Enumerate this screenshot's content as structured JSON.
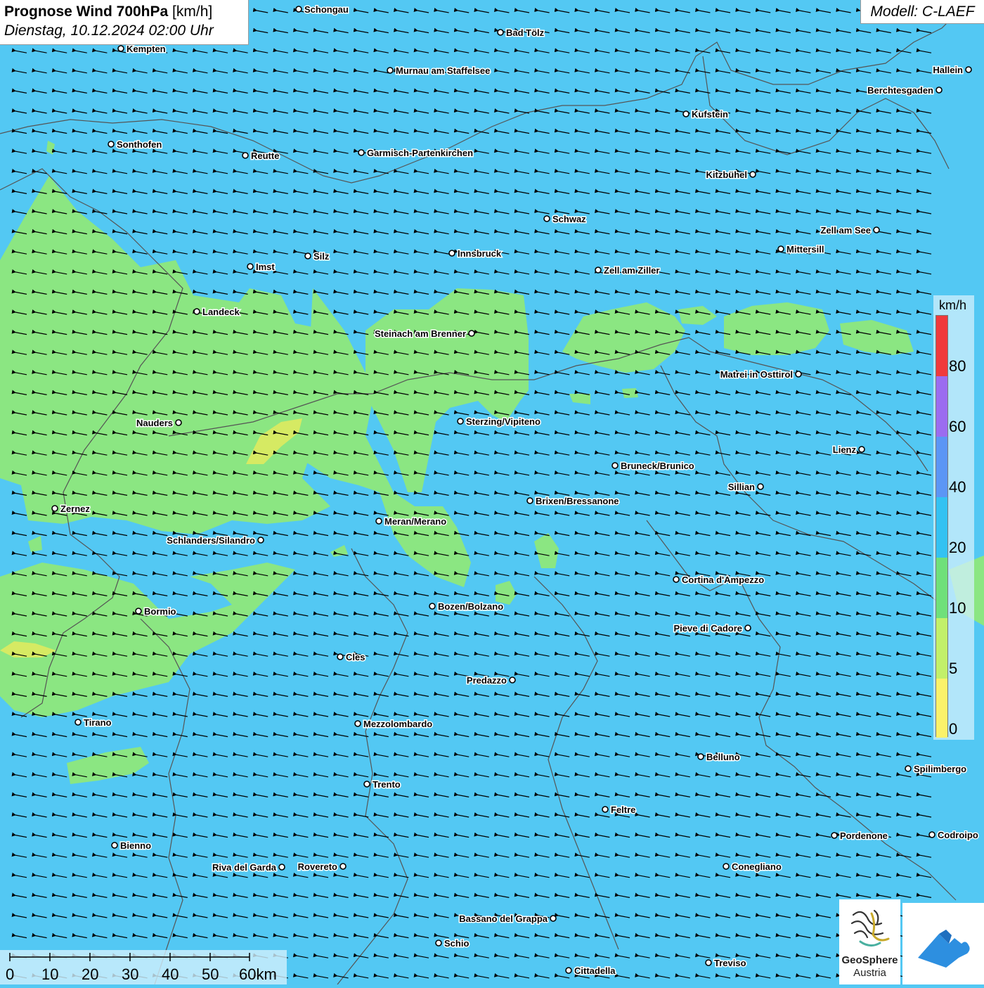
{
  "title": {
    "bold": "Prognose Wind 700hPa",
    "unit": " [km/h]",
    "date": "Dienstag, 10.12.2024 02:00 Uhr"
  },
  "model": "Modell: C-LAEF",
  "legend": {
    "unit": "km/h",
    "ticks": [
      "80",
      "60",
      "40",
      "20",
      "10",
      "5",
      "0"
    ],
    "colors": [
      "#f03a3c",
      "#9b6cf0",
      "#5b96f5",
      "#33c2f2",
      "#6fe07a",
      "#c2f06a",
      "#fbf26a"
    ]
  },
  "scale_bar": {
    "labels": [
      "0",
      "10",
      "20",
      "30",
      "40",
      "50",
      "60km"
    ]
  },
  "wind": {
    "direction": "from east (arrows pointing west)",
    "background_color": "#53c8f3",
    "low_wind_color": "#8be682",
    "calm_color": "#d6ea63"
  },
  "cities": [
    {
      "name": "Schongau"
    },
    {
      "name": "Bad Tölz"
    },
    {
      "name": "Kempten"
    },
    {
      "name": "Murnau am Staffelsee"
    },
    {
      "name": "Hallein"
    },
    {
      "name": "Berchtesgaden"
    },
    {
      "name": "Kufstein"
    },
    {
      "name": "Sonthofen"
    },
    {
      "name": "Reutte"
    },
    {
      "name": "Garmisch-Partenkirchen"
    },
    {
      "name": "Kitzbühel"
    },
    {
      "name": "Schwaz"
    },
    {
      "name": "Zell am See"
    },
    {
      "name": "Innsbruck"
    },
    {
      "name": "Mittersill"
    },
    {
      "name": "Imst"
    },
    {
      "name": "Silz"
    },
    {
      "name": "Zell am Ziller"
    },
    {
      "name": "Landeck"
    },
    {
      "name": "Steinach am Brenner"
    },
    {
      "name": "Matrei in Osttirol"
    },
    {
      "name": "Nauders"
    },
    {
      "name": "Sterzing/Vipiteno"
    },
    {
      "name": "Lienz"
    },
    {
      "name": "Bruneck/Brunico"
    },
    {
      "name": "Sillian"
    },
    {
      "name": "Brixen/Bressanone"
    },
    {
      "name": "Zernez"
    },
    {
      "name": "Meran/Merano"
    },
    {
      "name": "Schlanders/Silandro"
    },
    {
      "name": "Cortina d'Ampezzo"
    },
    {
      "name": "Bozen/Bolzano"
    },
    {
      "name": "Bormio"
    },
    {
      "name": "Pieve di Cadore"
    },
    {
      "name": "Cles"
    },
    {
      "name": "Predazzo"
    },
    {
      "name": "Tirano"
    },
    {
      "name": "Mezzolombardo"
    },
    {
      "name": "Belluno"
    },
    {
      "name": "Spilimbergo"
    },
    {
      "name": "Trento"
    },
    {
      "name": "Feltre"
    },
    {
      "name": "Bienno"
    },
    {
      "name": "Pordenone"
    },
    {
      "name": "Codroipo"
    },
    {
      "name": "Riva del Garda"
    },
    {
      "name": "Rovereto"
    },
    {
      "name": "Conegliano"
    },
    {
      "name": "Bassano del Grappa"
    },
    {
      "name": "Schio"
    },
    {
      "name": "Treviso"
    },
    {
      "name": "Cittadella"
    }
  ],
  "logos": {
    "geosphere_name": "GeoSphere",
    "geosphere_sub": "Austria"
  }
}
